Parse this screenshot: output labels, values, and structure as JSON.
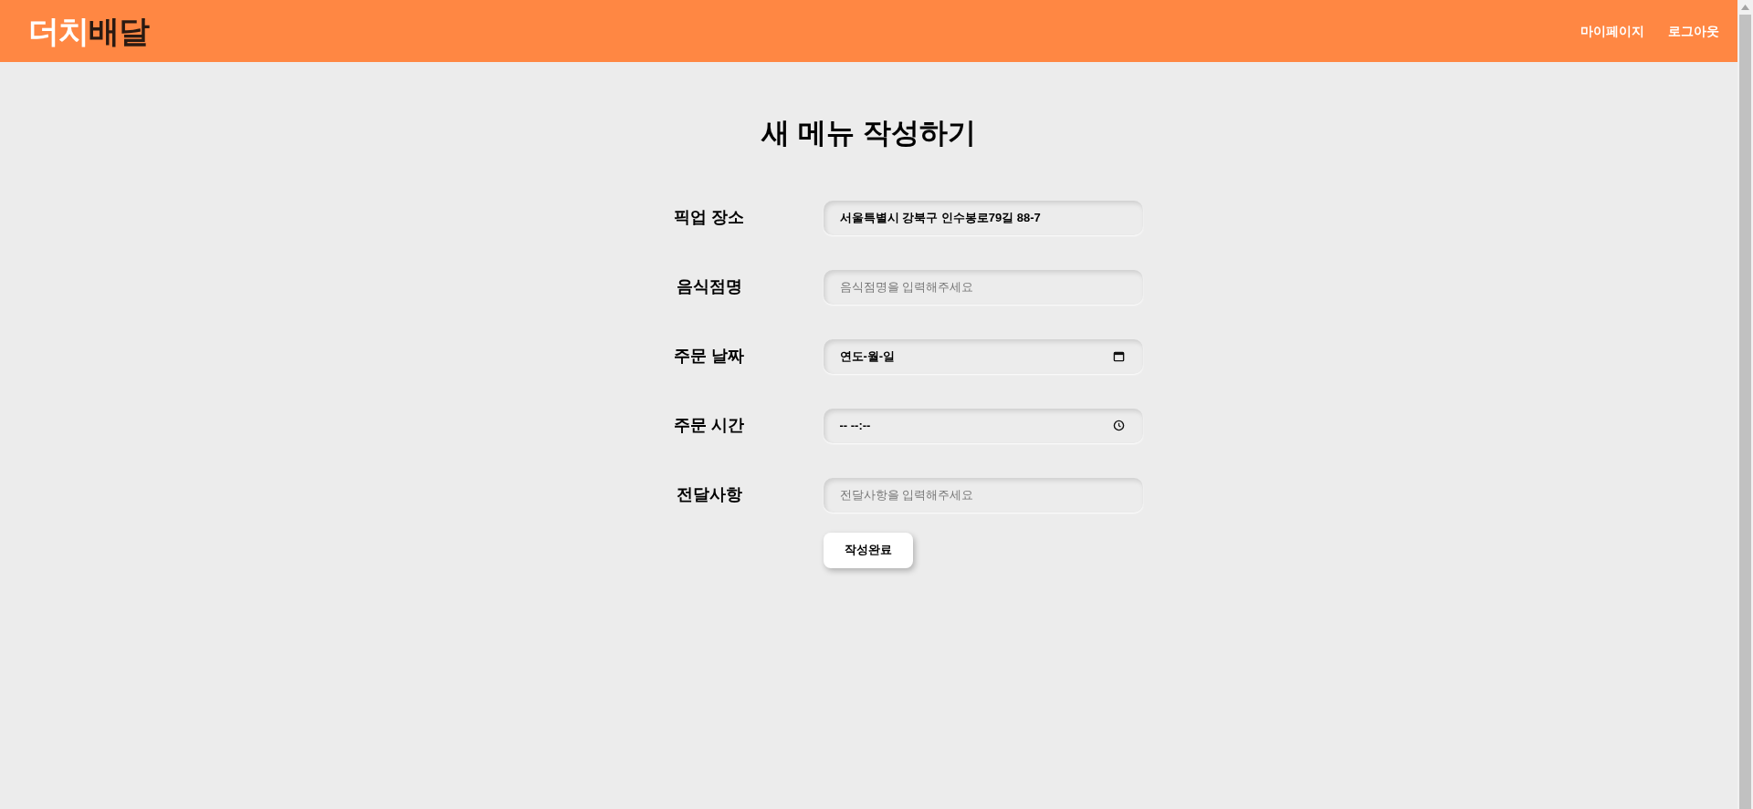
{
  "header": {
    "logo": {
      "part_1": "더치",
      "part_2": "배달"
    },
    "nav": [
      "마이페이지",
      "로그아웃"
    ]
  },
  "title": "새 메뉴 작성하기",
  "fields": [
    {
      "label": "픽업 장소",
      "kind": "text",
      "value": "서울특별시 강북구 인수봉로79길 88-7"
    },
    {
      "label": "음식점명",
      "kind": "text",
      "placeholder": "음식점명을 입력해주세요"
    },
    {
      "label": "주문 날짜",
      "kind": "date",
      "value": "연도-월-일"
    },
    {
      "label": "주문 시간",
      "kind": "time",
      "value": "-- --:--"
    },
    {
      "label": "전달사항",
      "kind": "text",
      "placeholder": "전달사항을 입력해주세요"
    }
  ],
  "submit": "작성완료"
}
